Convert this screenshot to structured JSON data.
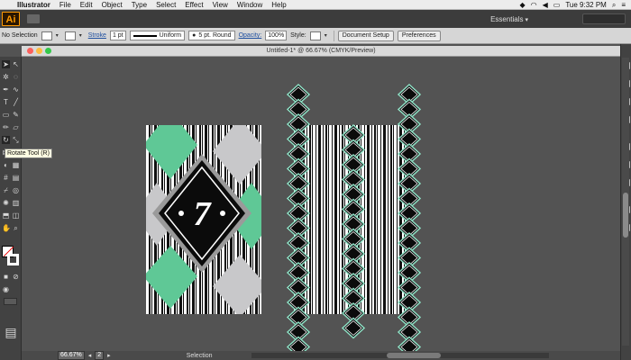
{
  "menubar": {
    "app_name": "Illustrator",
    "items": [
      "File",
      "Edit",
      "Object",
      "Type",
      "Select",
      "Effect",
      "View",
      "Window",
      "Help"
    ],
    "clock": "Tue 9:32 PM"
  },
  "appbar": {
    "logo": "Ai",
    "workspace": "Essentials"
  },
  "controlbar": {
    "selection": "No Selection",
    "stroke_label": "Stroke",
    "stroke_weight": "1 pt",
    "profile": "Uniform",
    "brush": "5 pt. Round",
    "opacity_label": "Opacity:",
    "opacity_value": "100%",
    "style_label": "Style:",
    "document_setup": "Document Setup",
    "preferences": "Preferences"
  },
  "document": {
    "title": "Untitled-1* @ 66.67% (CMYK/Preview)"
  },
  "tooltip": "Rotate Tool (R)",
  "statusbar": {
    "zoom": "66.67%",
    "page": "2",
    "tool": "Selection"
  },
  "artwork": {
    "card_number": "7"
  },
  "colors": {
    "mint": "#5fc896",
    "light_gray": "#c8c8ca",
    "black": "#0b0b0b",
    "diamond_outline": "#8fe0c5",
    "canvas": "#535353"
  }
}
